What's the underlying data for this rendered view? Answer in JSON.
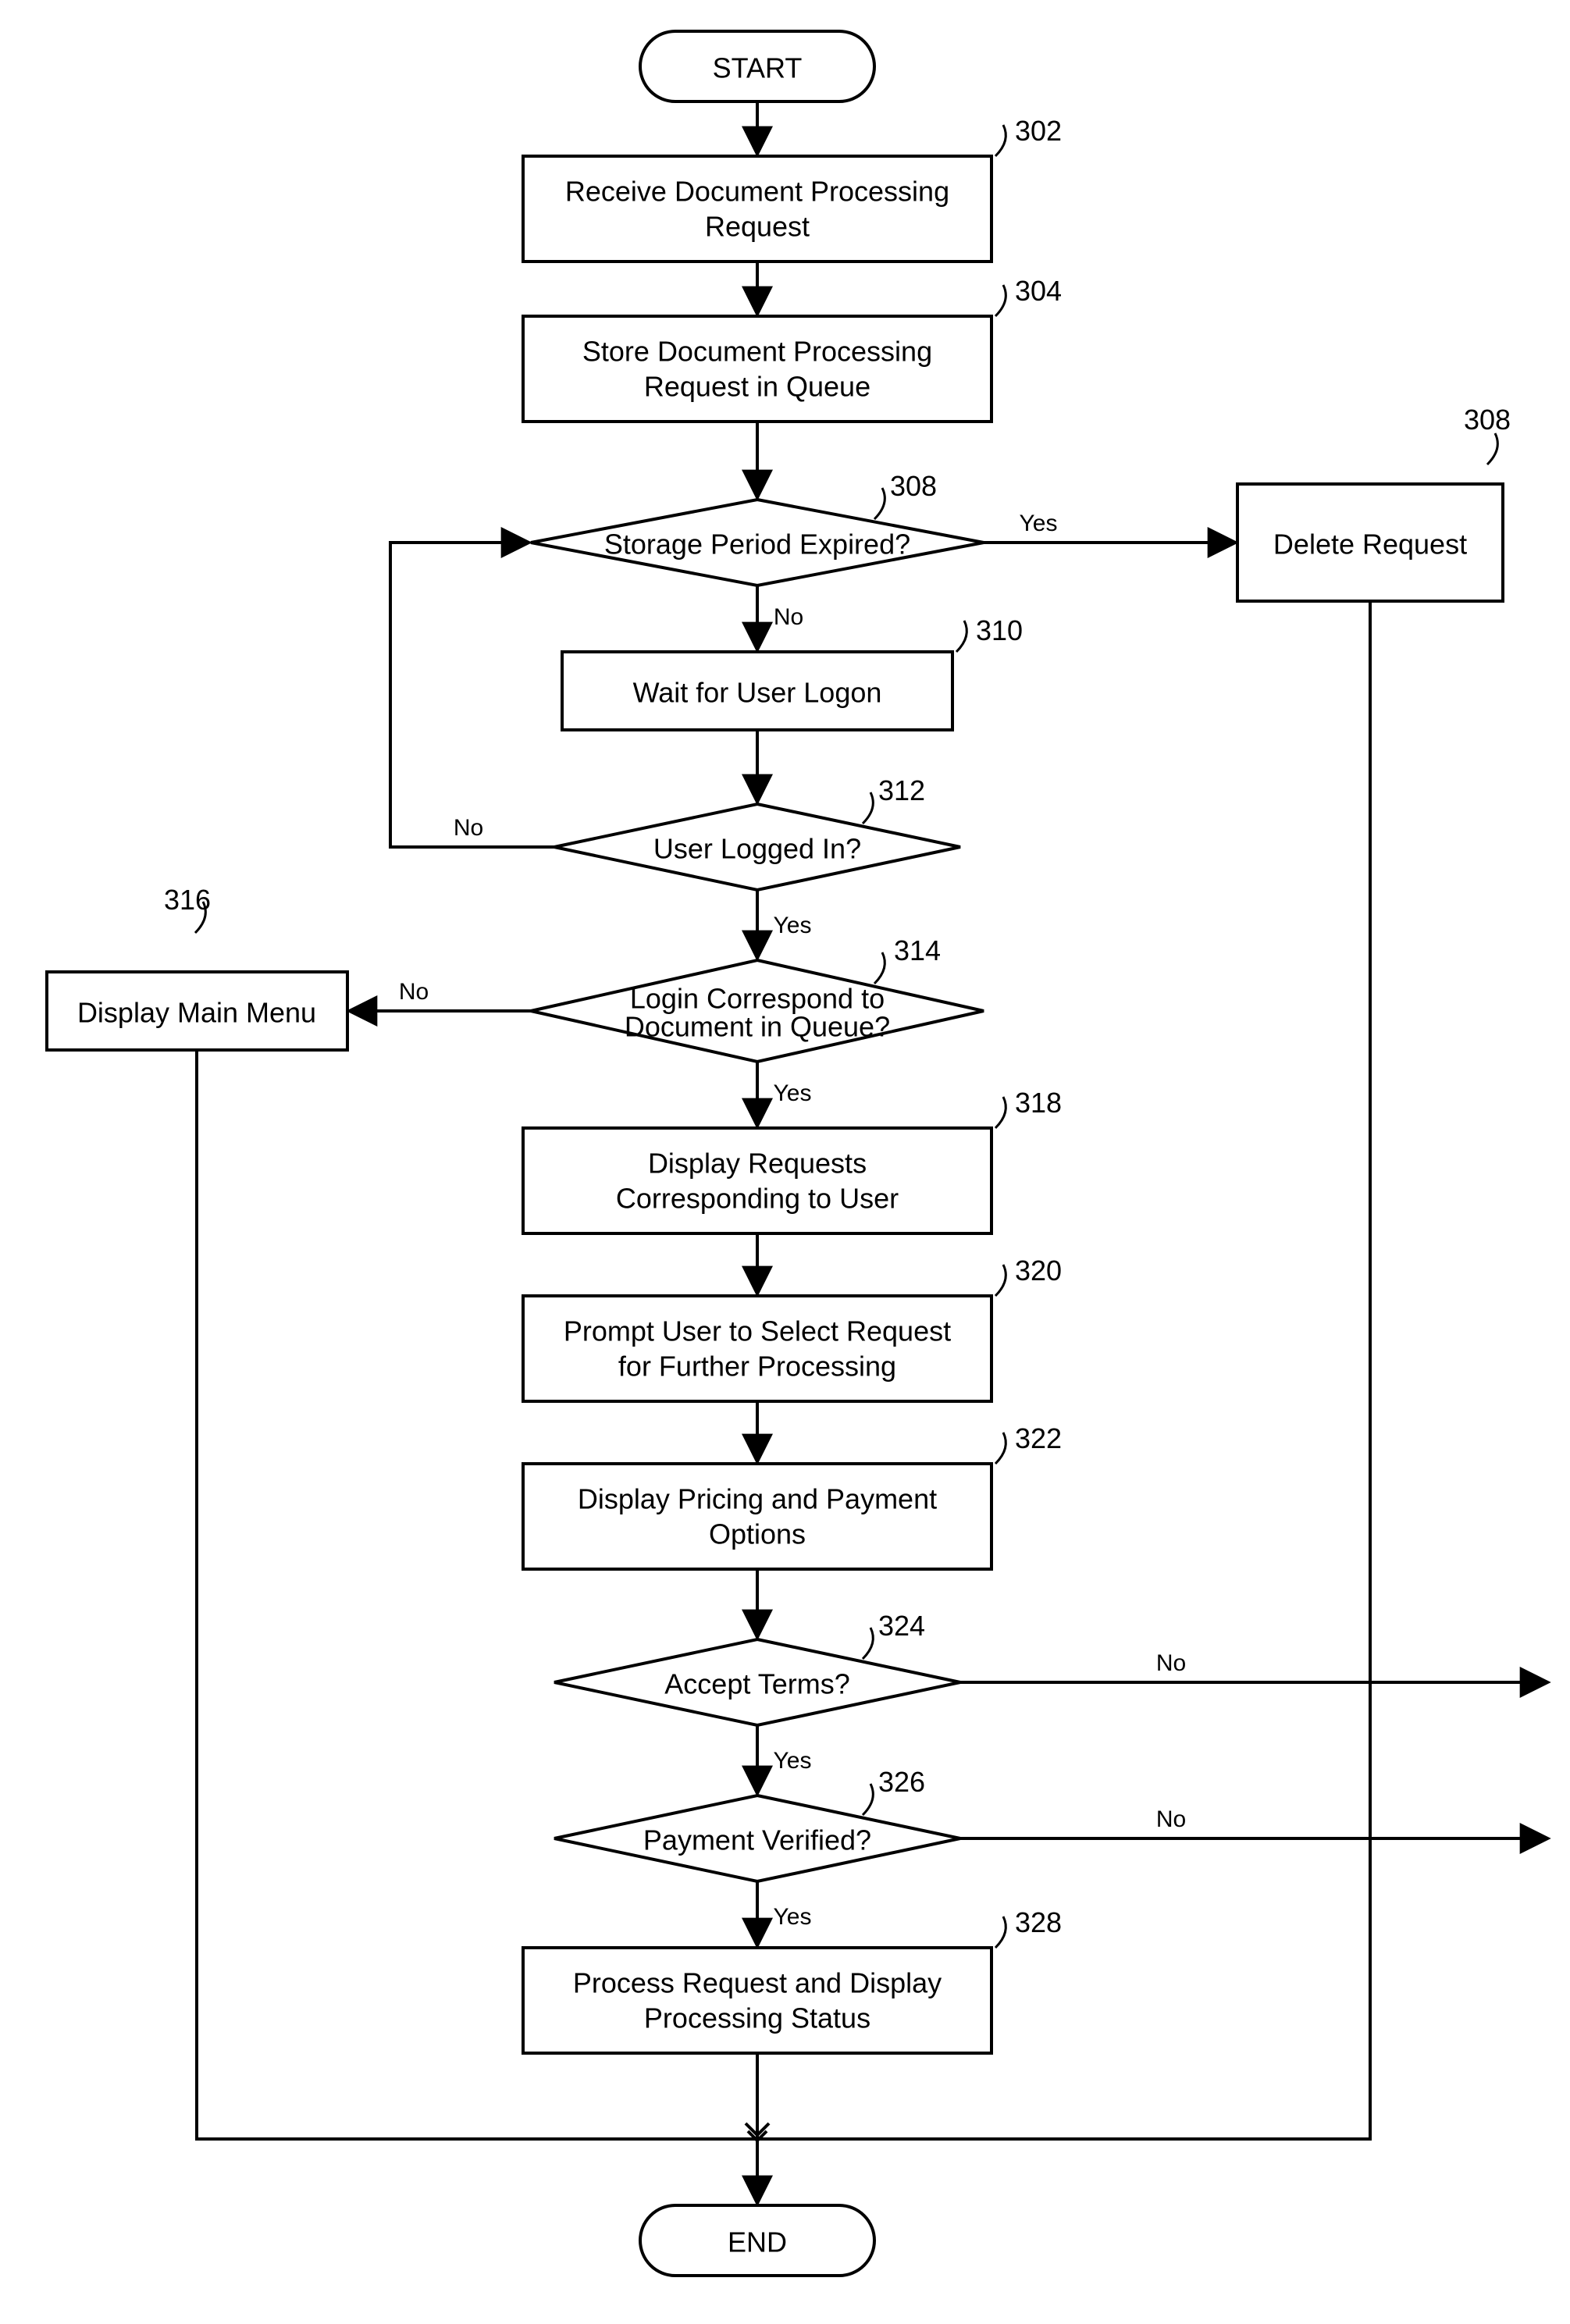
{
  "nodes": {
    "start": {
      "text": "START"
    },
    "n302": {
      "ref": "302",
      "line1": "Receive Document Processing",
      "line2": "Request"
    },
    "n304": {
      "ref": "304",
      "line1": "Store Document Processing",
      "line2": "Request in Queue"
    },
    "d308": {
      "ref": "308",
      "text": "Storage Period Expired?"
    },
    "b308": {
      "ref": "308",
      "text": "Delete Request"
    },
    "n310": {
      "ref": "310",
      "text": "Wait for User Logon"
    },
    "d312": {
      "ref": "312",
      "text": "User Logged In?"
    },
    "d314": {
      "ref": "314",
      "line1": "Login Correspond to",
      "line2": "Document in Queue?"
    },
    "n316": {
      "ref": "316",
      "text": "Display Main Menu"
    },
    "n318": {
      "ref": "318",
      "line1": "Display Requests",
      "line2": "Corresponding to User"
    },
    "n320": {
      "ref": "320",
      "line1": "Prompt User to Select Request",
      "line2": "for Further Processing"
    },
    "n322": {
      "ref": "322",
      "line1": "Display Pricing and Payment",
      "line2": "Options"
    },
    "d324": {
      "ref": "324",
      "text": "Accept Terms?"
    },
    "d326": {
      "ref": "326",
      "text": "Payment Verified?"
    },
    "n328": {
      "ref": "328",
      "line1": "Process Request and Display",
      "line2": "Processing Status"
    },
    "end": {
      "text": "END"
    }
  },
  "edges": {
    "yes": "Yes",
    "no": "No"
  }
}
